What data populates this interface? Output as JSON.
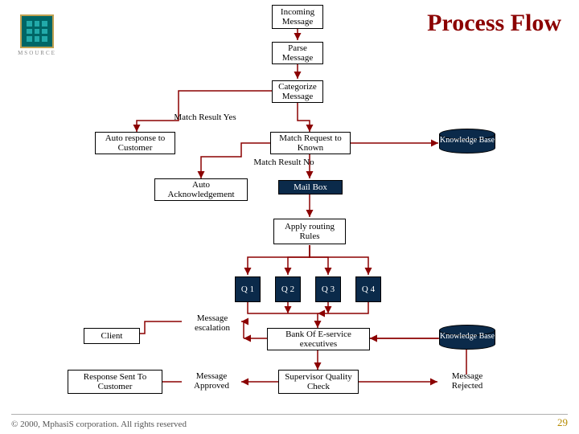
{
  "page": {
    "title": "Process Flow",
    "footer": "© 2000, MphasiS corporation. All rights reserved",
    "page_number": "29",
    "logo_caption": "MSOURCE"
  },
  "nodes": {
    "incoming": "Incoming\nMessage",
    "parse": "Parse\nMessage",
    "categorize": "Categorize\nMessage",
    "auto_response": "Auto response\nto Customer",
    "match_request": "Match Request\nto Known",
    "auto_ack": "Auto\nAcknowledgement",
    "mailbox": "Mail Box",
    "apply_rules": "Apply routing\nRules",
    "msg_escalation": "Message\nescalation",
    "client": "Client",
    "bank_exec": "Bank Of E-service\nexecutives",
    "response_sent": "Response Sent To\nCustomer",
    "msg_approved": "Message\nApproved",
    "supervisor": "Supervisor\nQuality Check",
    "msg_rejected": "Message\nRejected"
  },
  "labels": {
    "match_yes": "Match Result\nYes",
    "match_no": "Match Result No"
  },
  "queues": {
    "q1": "Q 1",
    "q2": "Q 2",
    "q3": "Q 3",
    "q4": "Q 4"
  },
  "kb": {
    "kb1": "Knowledge\nBase",
    "kb2": "Knowledge\nBase"
  }
}
